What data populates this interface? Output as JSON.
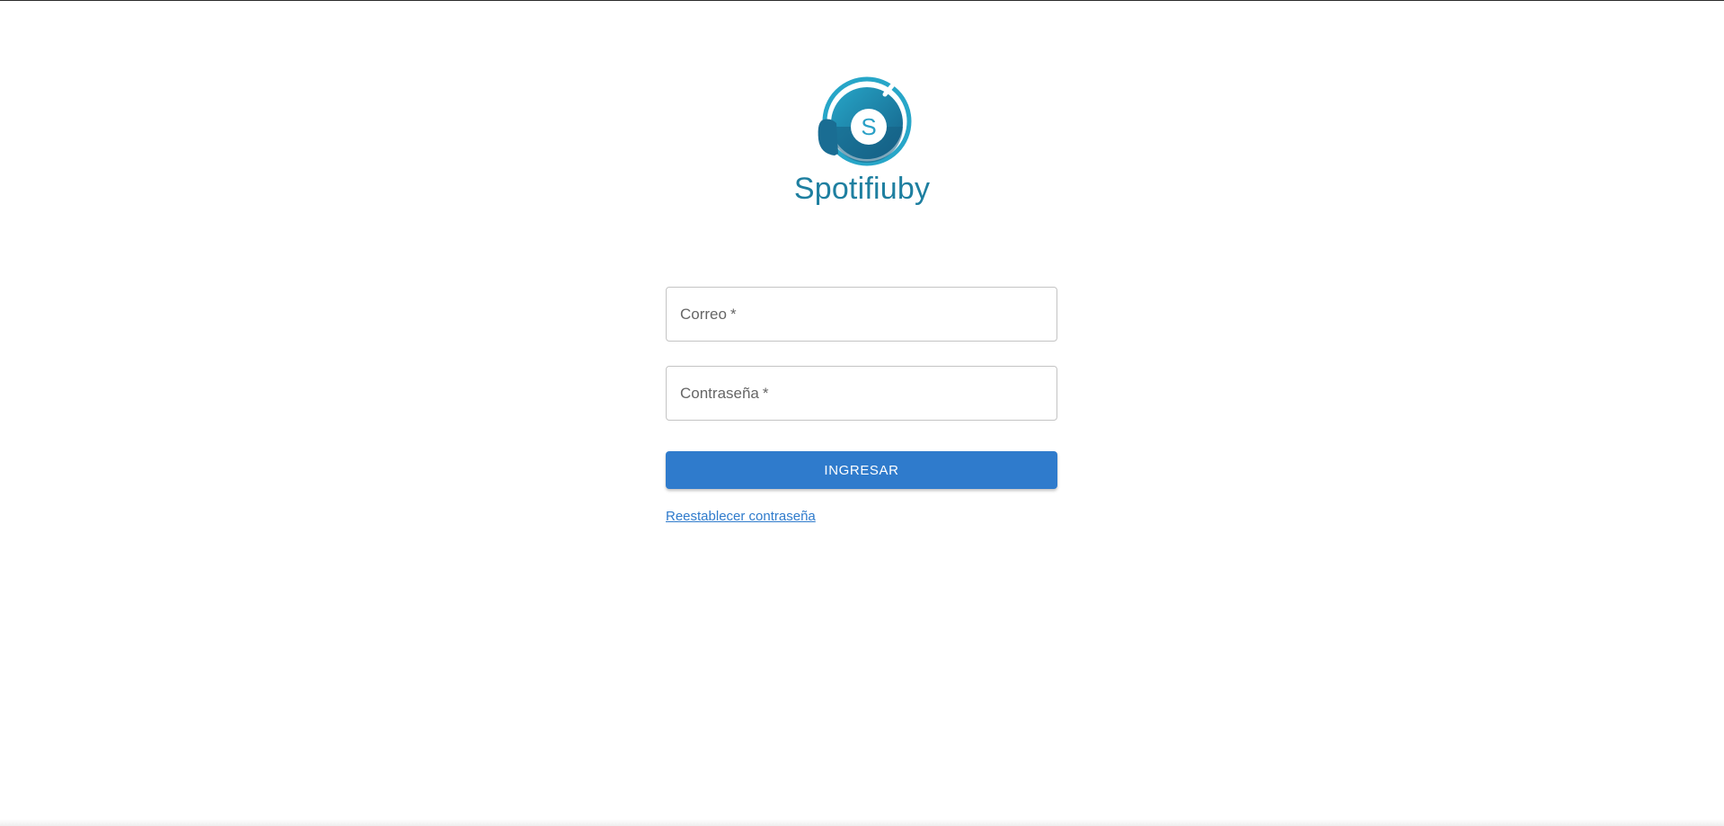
{
  "brand": {
    "name": "Spotifiuby",
    "logo_letter": "S",
    "logo_icon": "spotifiuby-logo-icon",
    "color": "#1e7fa0"
  },
  "form": {
    "email": {
      "label": "Correo",
      "required_mark": "*",
      "value": ""
    },
    "password": {
      "label": "Contraseña",
      "required_mark": "*",
      "value": ""
    },
    "submit_label": "INGRESAR",
    "reset_link_label": "Reestablecer contraseña"
  },
  "colors": {
    "primary": "#2f7bcc",
    "field_border": "#c4c4c4",
    "label": "#666666"
  }
}
